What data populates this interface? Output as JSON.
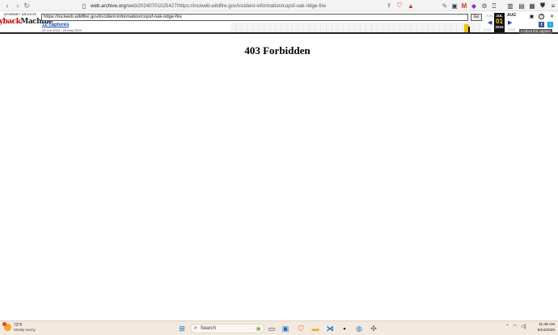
{
  "browser": {
    "url_domain": "web.archive.org",
    "url_path": "/web/20240701025427/https://inciweb.wildfire.gov/incident-information/copsf-oak-ridge-fire"
  },
  "wayback": {
    "logo_top": "INTERNET ARCHIVE",
    "logo_main_a": "Wayback",
    "logo_main_b": "Machine",
    "url_value": "https://inciweb.wildfire.gov/incident-information/copsf-oak-ridge-fire",
    "go_label": "Go",
    "captures": "12 captures",
    "date_range": "25 Jun 2024 - 28 May 2025",
    "prev_month": "JUN",
    "cur_month": "JUL",
    "cur_day": "01",
    "cur_year": "2024",
    "next_month": "AUG",
    "prev_year": "2023",
    "next_year": "2025",
    "about_label": "▾ About this capture"
  },
  "page": {
    "heading": "403 Forbidden"
  },
  "taskbar": {
    "temp": "72°F",
    "condition": "Mostly sunny",
    "search_label": "Search",
    "time": "11:48 AM",
    "date": "8/24/2025"
  }
}
